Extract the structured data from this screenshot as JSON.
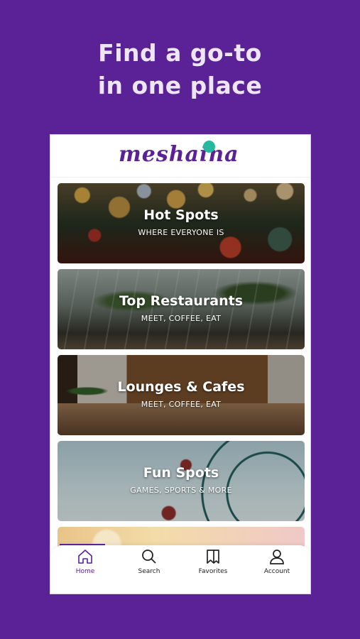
{
  "promo": {
    "headline_line1": "Find a go-to",
    "headline_line2": "in one place"
  },
  "app": {
    "logo_text": "meshaina"
  },
  "categories": [
    {
      "title": "Hot Spots",
      "subtitle": "WHERE EVERYONE IS"
    },
    {
      "title": "Top Restaurants",
      "subtitle": "MEET, COFFEE, EAT"
    },
    {
      "title": "Lounges & Cafes",
      "subtitle": "MEET, COFFEE, EAT"
    },
    {
      "title": "Fun Spots",
      "subtitle": "GAMES, SPORTS & MORE"
    }
  ],
  "tabbar": {
    "tabs": [
      {
        "label": "Home",
        "icon": "home-icon",
        "active": true
      },
      {
        "label": "Search",
        "icon": "search-icon",
        "active": false
      },
      {
        "label": "Favorites",
        "icon": "bookmark-icon",
        "active": false
      },
      {
        "label": "Account",
        "icon": "user-icon",
        "active": false
      }
    ]
  },
  "colors": {
    "background": "#5b2196",
    "brand": "#5b2196",
    "accent_dot": "#25b9a0",
    "headline": "#ece6f7"
  }
}
